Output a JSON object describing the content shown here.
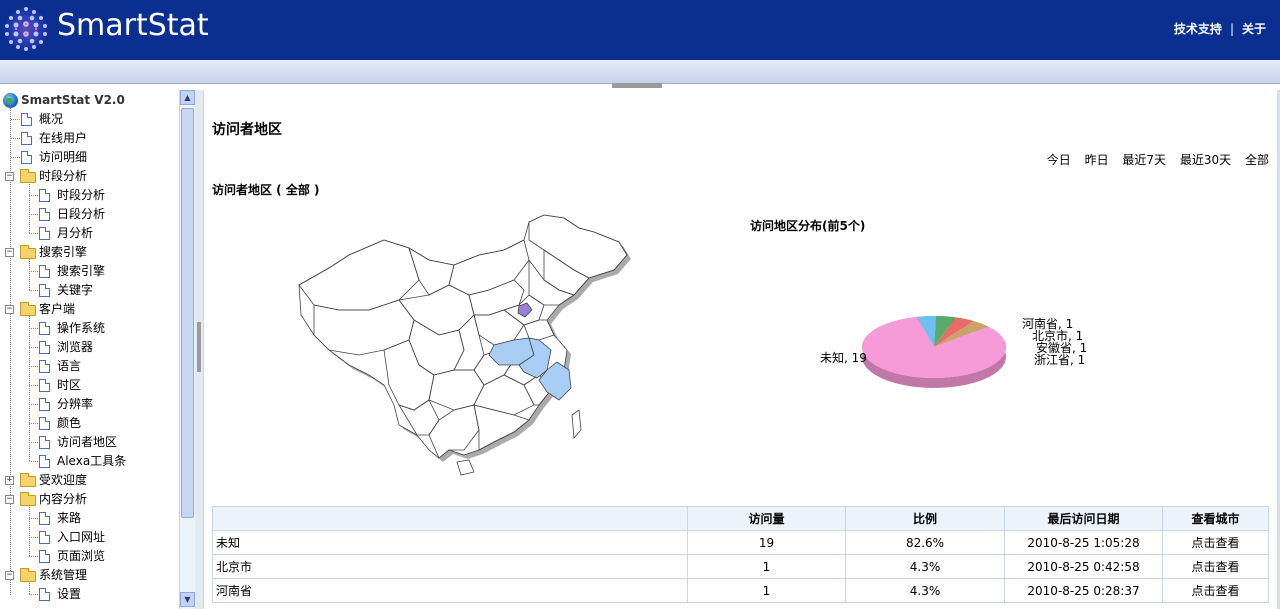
{
  "app": {
    "logo_text": "SmartStat",
    "top_links": [
      "技术支持",
      "关于"
    ],
    "colors": {
      "header_bg": "#0a2f91",
      "map_highlight": "#a9cdf5",
      "map_beijing": "#9a7fd6"
    }
  },
  "sidebar": {
    "root": "SmartStat V2.0",
    "items": [
      {
        "label": "概况",
        "type": "doc",
        "level": 1
      },
      {
        "label": "在线用户",
        "type": "doc",
        "level": 1
      },
      {
        "label": "访问明细",
        "type": "doc",
        "level": 1
      },
      {
        "label": "时段分析",
        "type": "folder",
        "level": 1,
        "expanded": true
      },
      {
        "label": "时段分析",
        "type": "doc",
        "level": 2
      },
      {
        "label": "日段分析",
        "type": "doc",
        "level": 2
      },
      {
        "label": "月分析",
        "type": "doc",
        "level": 2
      },
      {
        "label": "搜索引擎",
        "type": "folder",
        "level": 1,
        "expanded": true
      },
      {
        "label": "搜索引擎",
        "type": "doc",
        "level": 2
      },
      {
        "label": "关键字",
        "type": "doc",
        "level": 2
      },
      {
        "label": "客户端",
        "type": "folder",
        "level": 1,
        "expanded": true
      },
      {
        "label": "操作系统",
        "type": "doc",
        "level": 2
      },
      {
        "label": "浏览器",
        "type": "doc",
        "level": 2
      },
      {
        "label": "语言",
        "type": "doc",
        "level": 2
      },
      {
        "label": "时区",
        "type": "doc",
        "level": 2
      },
      {
        "label": "分辨率",
        "type": "doc",
        "level": 2
      },
      {
        "label": "颜色",
        "type": "doc",
        "level": 2
      },
      {
        "label": "访问者地区",
        "type": "doc",
        "level": 2
      },
      {
        "label": "Alexa工具条",
        "type": "doc",
        "level": 2
      },
      {
        "label": "受欢迎度",
        "type": "folder",
        "level": 1,
        "expanded": false
      },
      {
        "label": "内容分析",
        "type": "folder",
        "level": 1,
        "expanded": true
      },
      {
        "label": "来路",
        "type": "doc",
        "level": 2
      },
      {
        "label": "入口网址",
        "type": "doc",
        "level": 2
      },
      {
        "label": "页面浏览",
        "type": "doc",
        "level": 2
      },
      {
        "label": "系统管理",
        "type": "folder",
        "level": 1,
        "expanded": true
      },
      {
        "label": "设置",
        "type": "doc",
        "level": 2
      }
    ]
  },
  "main": {
    "title": "访问者地区",
    "periods": [
      "今日",
      "昨日",
      "最近7天",
      "最近30天",
      "全部"
    ],
    "section_title": "访问者地区 ( 全部 )",
    "pie_title": "访问地区分布(前5个)",
    "table": {
      "headers": [
        "",
        "访问量",
        "比例",
        "最后访问日期",
        "查看城市"
      ],
      "rows": [
        {
          "region": "未知",
          "visits": "19",
          "ratio": "82.6%",
          "last": "2010-8-25 1:05:28",
          "action": "点击查看"
        },
        {
          "region": "北京市",
          "visits": "1",
          "ratio": "4.3%",
          "last": "2010-8-25 0:42:58",
          "action": "点击查看"
        },
        {
          "region": "河南省",
          "visits": "1",
          "ratio": "4.3%",
          "last": "2010-8-25 0:28:37",
          "action": "点击查看"
        }
      ]
    }
  },
  "chart_data": {
    "type": "pie",
    "title": "访问地区分布(前5个)",
    "slices": [
      {
        "label": "未知, 19",
        "name": "未知",
        "value": 19,
        "color": "#f79ad8"
      },
      {
        "label": "河南省, 1",
        "name": "河南省",
        "value": 1,
        "color": "#6ec0f4"
      },
      {
        "label": "北京市, 1",
        "name": "北京市",
        "value": 1,
        "color": "#5aab6a"
      },
      {
        "label": "安徽省, 1",
        "name": "安徽省",
        "value": 1,
        "color": "#ea6a6a"
      },
      {
        "label": "浙江省, 1",
        "name": "浙江省",
        "value": 1,
        "color": "#c9a36a"
      }
    ]
  }
}
